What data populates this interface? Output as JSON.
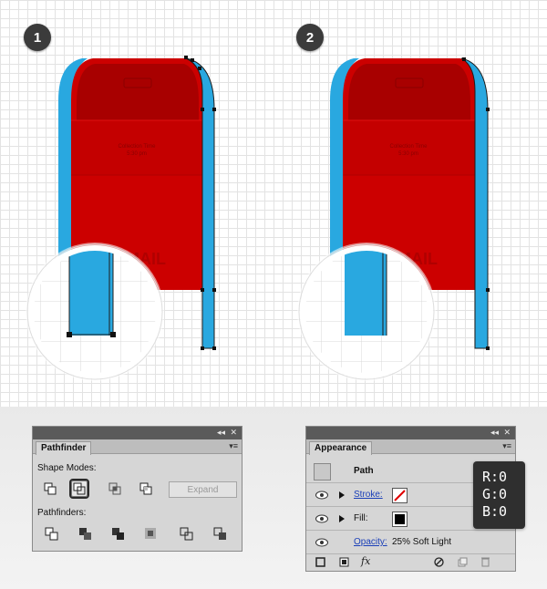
{
  "steps": [
    "1",
    "2"
  ],
  "mailbox": {
    "label_line1": "Collection Time",
    "label_line2": "5:30 pm",
    "logo_text": "MAIL"
  },
  "pathfinder": {
    "tab": "Pathfinder",
    "shape_modes_label": "Shape Modes:",
    "pathfinders_label": "Pathfinders:",
    "expand_label": "Expand",
    "collapse_glyph": "◂◂",
    "close_glyph": "✕",
    "menu_glyph": "▾≡"
  },
  "appearance": {
    "tab": "Appearance",
    "path_label": "Path",
    "stroke_label": "Stroke:",
    "fill_label": "Fill:",
    "opacity_label": "Opacity:",
    "opacity_value": "25% Soft Light",
    "fx_label": "fx",
    "collapse_glyph": "◂◂",
    "close_glyph": "✕",
    "menu_glyph": "▾≡"
  },
  "tooltip": {
    "r": "R:0",
    "g": "G:0",
    "b": "B:0"
  },
  "colors": {
    "red": "#cc0000",
    "blue": "#29a8e0",
    "panel": "#d6d6d6"
  }
}
